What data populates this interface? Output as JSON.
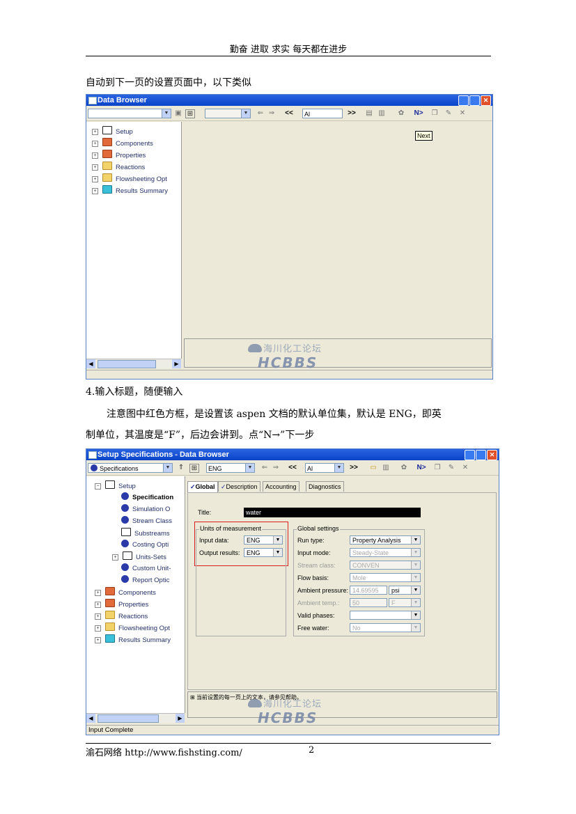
{
  "header": {
    "text": "勤奋 进取 求实 每天都在进步"
  },
  "body": {
    "para1": "自动到下一页的设置页面中，以下类似",
    "step4": "4.输入标题，随便输入",
    "para2_line1": "注意图中红色方框，是设置该 aspen 文档的默认单位集，默认是 ENG，即英",
    "para2_line2": "制单位，其温度是“F”，后边会讲到。点“N→”下一步"
  },
  "screen1": {
    "title": "Data Browser",
    "toolbar": {
      "prev_label": "<<",
      "all_combo": "Al",
      "next_label": ">>",
      "next_btn": "N>"
    },
    "tooltip": "Next",
    "tree": [
      {
        "label": "Setup"
      },
      {
        "label": "Components"
      },
      {
        "label": "Properties"
      },
      {
        "label": "Reactions"
      },
      {
        "label": "Flowsheeting Opt"
      },
      {
        "label": "Results Summary"
      }
    ]
  },
  "screen2": {
    "title": "Setup Specifications - Data Browser",
    "toolbar": {
      "nav_combo": "Specifications",
      "unit_combo": "ENG",
      "prev_label": "<<",
      "all_combo": "Al",
      "next_label": ">>",
      "next_btn": "N>"
    },
    "tree": [
      {
        "label": "Setup"
      },
      {
        "label": "Specification"
      },
      {
        "label": "Simulation O"
      },
      {
        "label": "Stream Class"
      },
      {
        "label": "Substreams"
      },
      {
        "label": "Costing Opti"
      },
      {
        "label": "Units-Sets"
      },
      {
        "label": "Custom Unit-"
      },
      {
        "label": "Report Optic"
      },
      {
        "label": "Components"
      },
      {
        "label": "Properties"
      },
      {
        "label": "Reactions"
      },
      {
        "label": "Flowsheeting Opt"
      },
      {
        "label": "Results Summary"
      }
    ],
    "tabs": [
      "Global",
      "Description",
      "Accounting",
      "Diagnostics"
    ],
    "title_label": "Title:",
    "title_value": "water",
    "units_group": "Units of measurement",
    "input_data_label": "Input data:",
    "input_data_value": "ENG",
    "output_results_label": "Output results:",
    "output_results_value": "ENG",
    "global_group": "Global settings",
    "settings": [
      {
        "label": "Run type:",
        "value": "Property Analysis",
        "disabled": false
      },
      {
        "label": "Input mode:",
        "value": "Steady-State",
        "disabled": false
      },
      {
        "label": "Stream class:",
        "value": "CONVEN",
        "disabled": true
      },
      {
        "label": "Flow basis:",
        "value": "Mole",
        "disabled": false
      },
      {
        "label": "Ambient pressure:",
        "value": "14.69595",
        "unit": "psi",
        "disabled": false
      },
      {
        "label": "Ambient temp.:",
        "value": "50",
        "unit": "F",
        "disabled": true
      },
      {
        "label": "Valid phases:",
        "value": "",
        "disabled": false
      },
      {
        "label": "Free water:",
        "value": "No",
        "disabled": false
      }
    ],
    "message": "当前设置的每一页上的文本，请参见帮助。",
    "status": "Input Complete"
  },
  "watermark": {
    "cn": "海川化工论坛",
    "en": "HCBBS"
  },
  "footer": {
    "left": "渝石网络 http://www.fishsting.com/",
    "page": "2"
  }
}
